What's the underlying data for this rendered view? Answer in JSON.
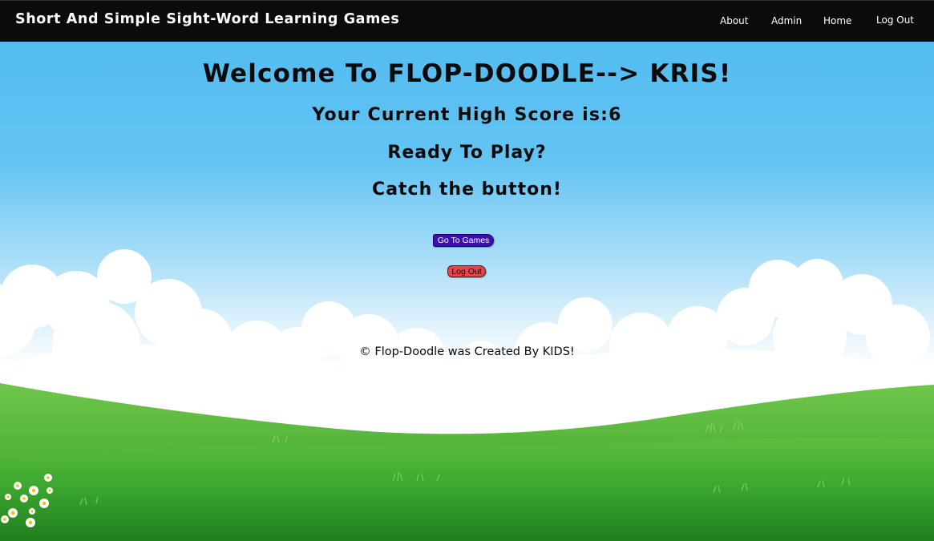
{
  "navbar": {
    "brand": "Short And Simple Sight-Word Learning Games",
    "links": [
      {
        "label": "About"
      },
      {
        "label": "Admin"
      },
      {
        "label": "Home"
      },
      {
        "label": "Log Out"
      }
    ]
  },
  "main": {
    "welcome": "Welcome To FLOP-DOODLE--> KRIS!",
    "score_prefix": "Your Current High Score is:",
    "high_score": "6",
    "ready": "Ready To Play?",
    "catch": "Catch the button!",
    "games_button": "Go To Games",
    "logout_button": "Log Out",
    "footer": "© Flop-Doodle was Created By KIDS!"
  },
  "colors": {
    "navbar_bg": "#0b0b0b",
    "sky": "#4fb9ef",
    "grass": "#3aa52e",
    "games_button": "#3b0fb0",
    "logout_button": "#e0474c"
  },
  "icons": [
    "cloud-icon",
    "flower-icon"
  ]
}
